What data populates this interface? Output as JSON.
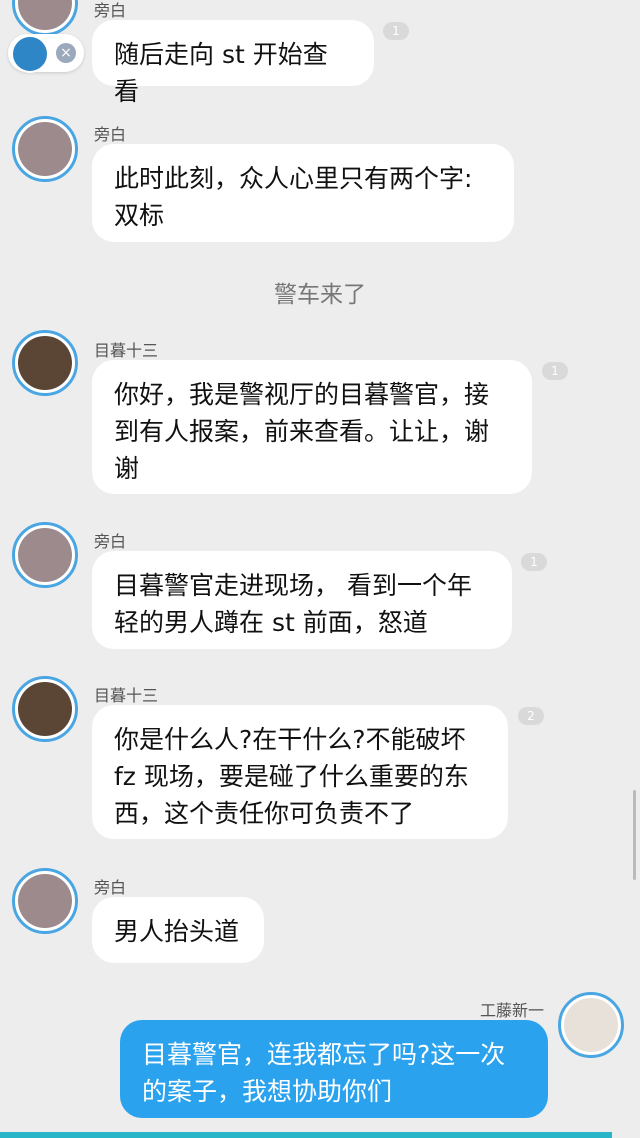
{
  "messages": [
    {
      "name": "旁白",
      "text": "随后走向 st 开始查看",
      "badge": "1"
    },
    {
      "name": "旁白",
      "text": "此时此刻，众人心里只有两个字:\n双标"
    },
    {
      "name": "目暮十三",
      "text": "你好，我是警视厅的目暮警官，接\n到有人报案，前来查看。让让，谢\n谢",
      "badge": "1"
    },
    {
      "name": "旁白",
      "text": "目暮警官走进现场， 看到一个年\n轻的男人蹲在 st 前面，怒道",
      "badge": "1"
    },
    {
      "name": "目暮十三",
      "text": "你是什么人?在干什么?不能破坏\nfz 现场，要是碰了什么重要的东\n西，这个责任你可负责不了",
      "badge": "2"
    },
    {
      "name": "旁白",
      "text": "男人抬头道"
    },
    {
      "name": "工藤新一",
      "text": "目暮警官，连我都忘了吗?这一次\n的案子，我想协助你们"
    }
  ],
  "narration": "警车来了",
  "float_tool": {
    "close_label": "×"
  },
  "colors": {
    "accent": "#2aa2ee",
    "avatar_ring": "#4aa6e2",
    "bottom_bar": "#27b5c7"
  }
}
